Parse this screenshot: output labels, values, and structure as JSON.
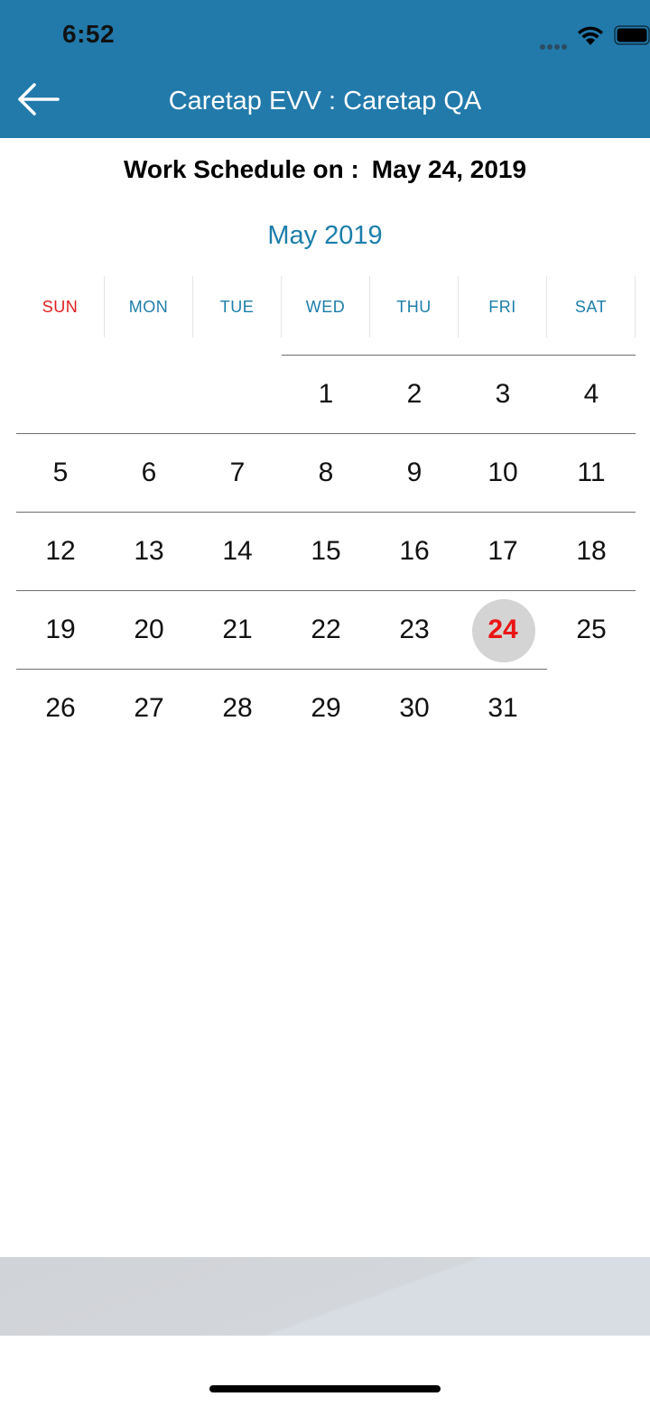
{
  "status_bar": {
    "time": "6:52"
  },
  "nav": {
    "title": "Caretap EVV : Caretap QA",
    "back_icon": "arrow-left-icon"
  },
  "schedule": {
    "label": "Work Schedule on :",
    "date": "May 24, 2019"
  },
  "calendar": {
    "month_label": "May 2019",
    "weekdays": [
      "SUN",
      "MON",
      "TUE",
      "WED",
      "THU",
      "FRI",
      "SAT"
    ],
    "first_weekday_index": 3,
    "days_in_month": 31,
    "selected_day": 24,
    "days": [
      "1",
      "2",
      "3",
      "4",
      "5",
      "6",
      "7",
      "8",
      "9",
      "10",
      "11",
      "12",
      "13",
      "14",
      "15",
      "16",
      "17",
      "18",
      "19",
      "20",
      "21",
      "22",
      "23",
      "24",
      "25",
      "26",
      "27",
      "28",
      "29",
      "30",
      "31"
    ]
  },
  "colors": {
    "header": "#227aab",
    "accent": "#1c7eaa",
    "sunday": "#e11c1c",
    "selected_text": "#ea1515",
    "selected_bg": "#d4d4d4"
  }
}
